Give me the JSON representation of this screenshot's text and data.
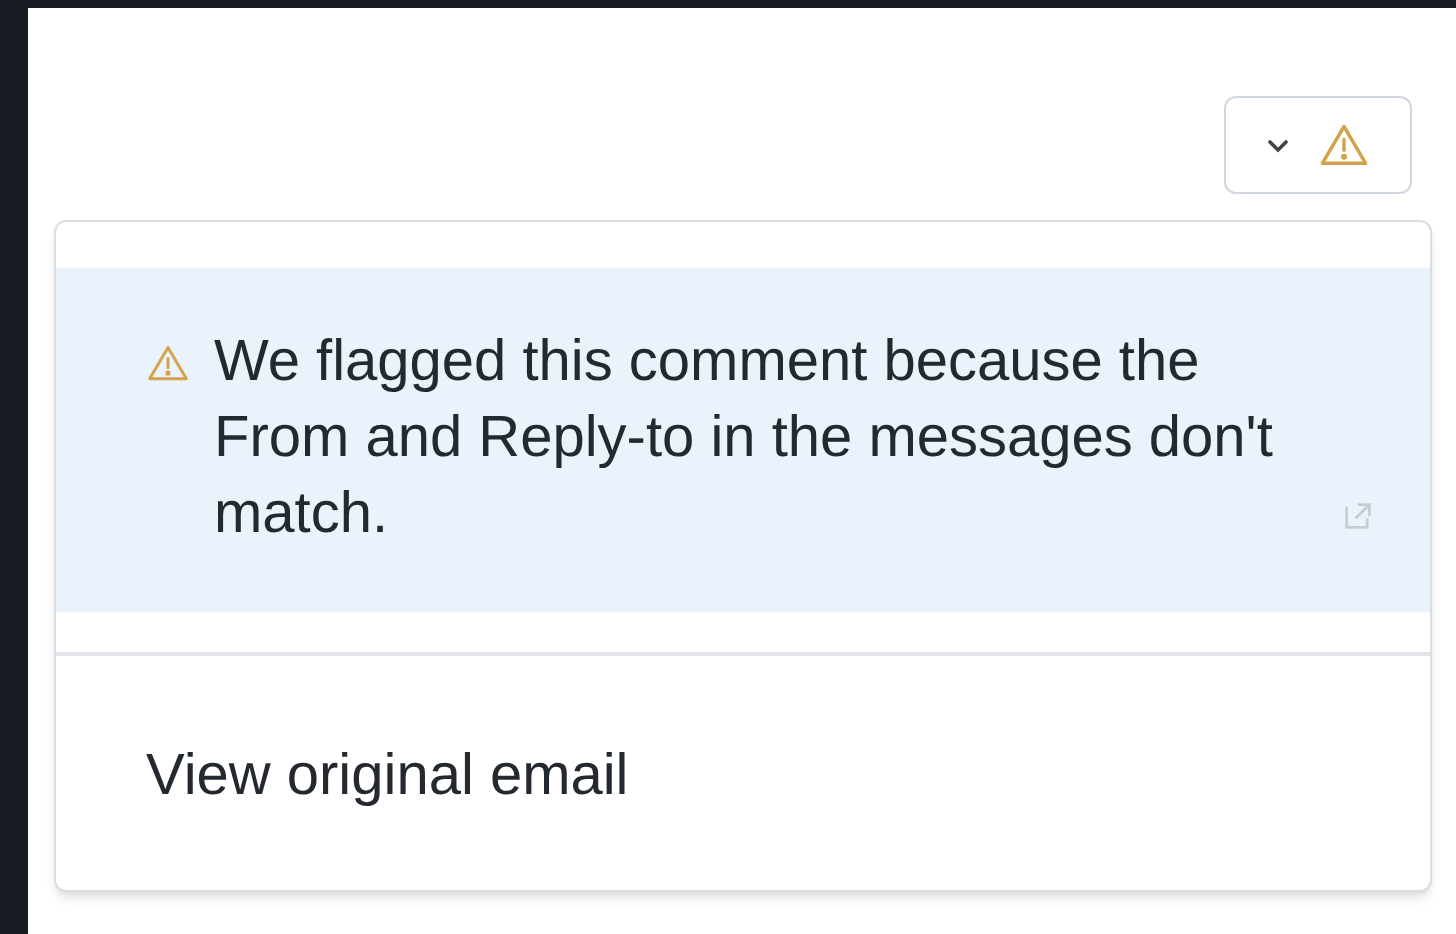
{
  "menu_button": {
    "expanded": true
  },
  "menu": {
    "warning": "We flagged this comment because the From and Reply-to in the messages don't match.",
    "items": [
      {
        "label": "View original email"
      }
    ]
  }
}
